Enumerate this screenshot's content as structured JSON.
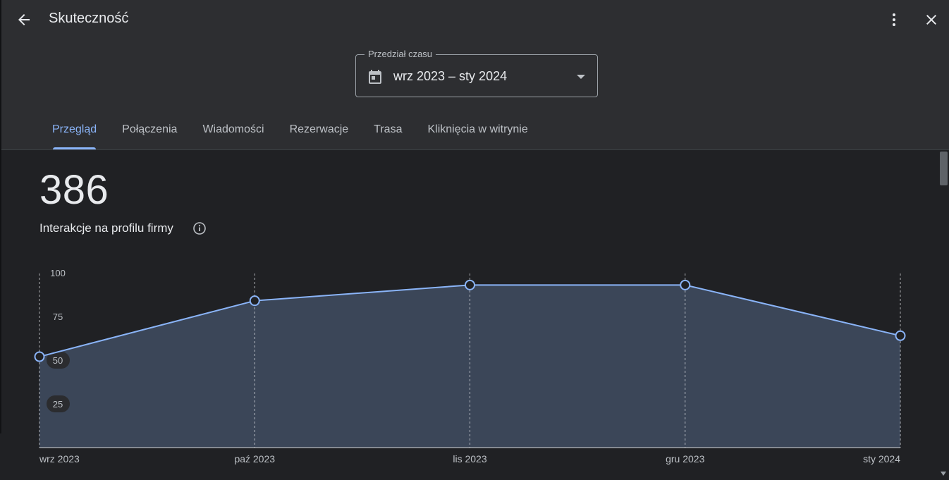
{
  "header": {
    "title": "Skuteczność",
    "back_icon": "arrow-back-icon",
    "more_icon": "more-vert-icon",
    "close_icon": "close-icon"
  },
  "date_range": {
    "label": "Przedział czasu",
    "value": "wrz 2023 – sty 2024",
    "icon": "calendar-icon"
  },
  "tabs": [
    {
      "label": "Przegląd",
      "active": true
    },
    {
      "label": "Połączenia"
    },
    {
      "label": "Wiadomości"
    },
    {
      "label": "Rezerwacje"
    },
    {
      "label": "Trasa"
    },
    {
      "label": "Kliknięcia w witrynie"
    }
  ],
  "metric": {
    "value": "386",
    "label": "Interakcje na profilu firmy"
  },
  "colors": {
    "accent": "#8ab4f8",
    "area_fill": "#3b4658",
    "background": "#202124",
    "header_bg": "#2d2e31"
  },
  "chart_data": {
    "type": "area",
    "categories": [
      "wrz 2023",
      "paź 2023",
      "lis 2023",
      "gru 2023",
      "sty 2024"
    ],
    "values": [
      52,
      84,
      93,
      93,
      64
    ],
    "yticks": [
      25,
      50,
      75,
      100
    ],
    "ylim": [
      0,
      100
    ],
    "title": "",
    "xlabel": "",
    "ylabel": "",
    "grid": "vertical-dashed"
  }
}
